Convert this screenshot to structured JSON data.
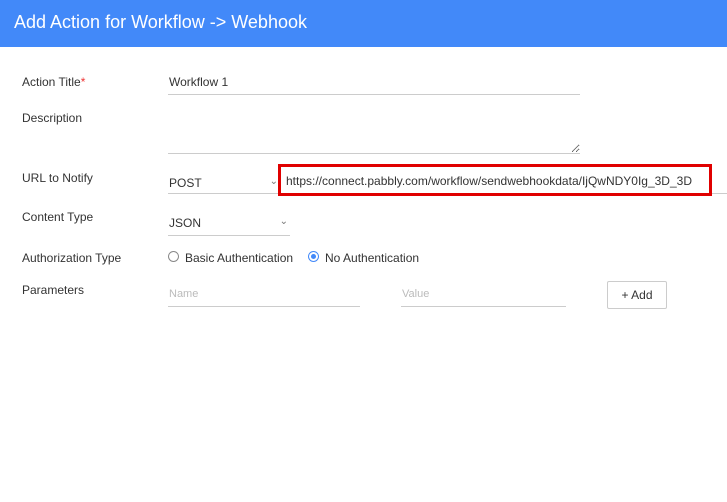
{
  "header": {
    "title": "Add Action for Workflow -> Webhook"
  },
  "colors": {
    "accent": "#4289f9",
    "highlight": "#e00000"
  },
  "form": {
    "action_title": {
      "label": "Action Title",
      "required_mark": "*",
      "value": "Workflow 1"
    },
    "description": {
      "label": "Description",
      "value": ""
    },
    "url": {
      "label": "URL to Notify",
      "method": "POST",
      "value": "https://connect.pabbly.com/workflow/sendwebhookdata/IjQwNDY0Ig_3D_3D"
    },
    "content_type": {
      "label": "Content Type",
      "value": "JSON"
    },
    "authorization": {
      "label": "Authorization Type",
      "options": [
        "Basic Authentication",
        "No Authentication"
      ],
      "selected": "No Authentication"
    },
    "parameters": {
      "label": "Parameters",
      "name_placeholder": "Name",
      "value_placeholder": "Value",
      "add_label": "+ Add"
    }
  }
}
